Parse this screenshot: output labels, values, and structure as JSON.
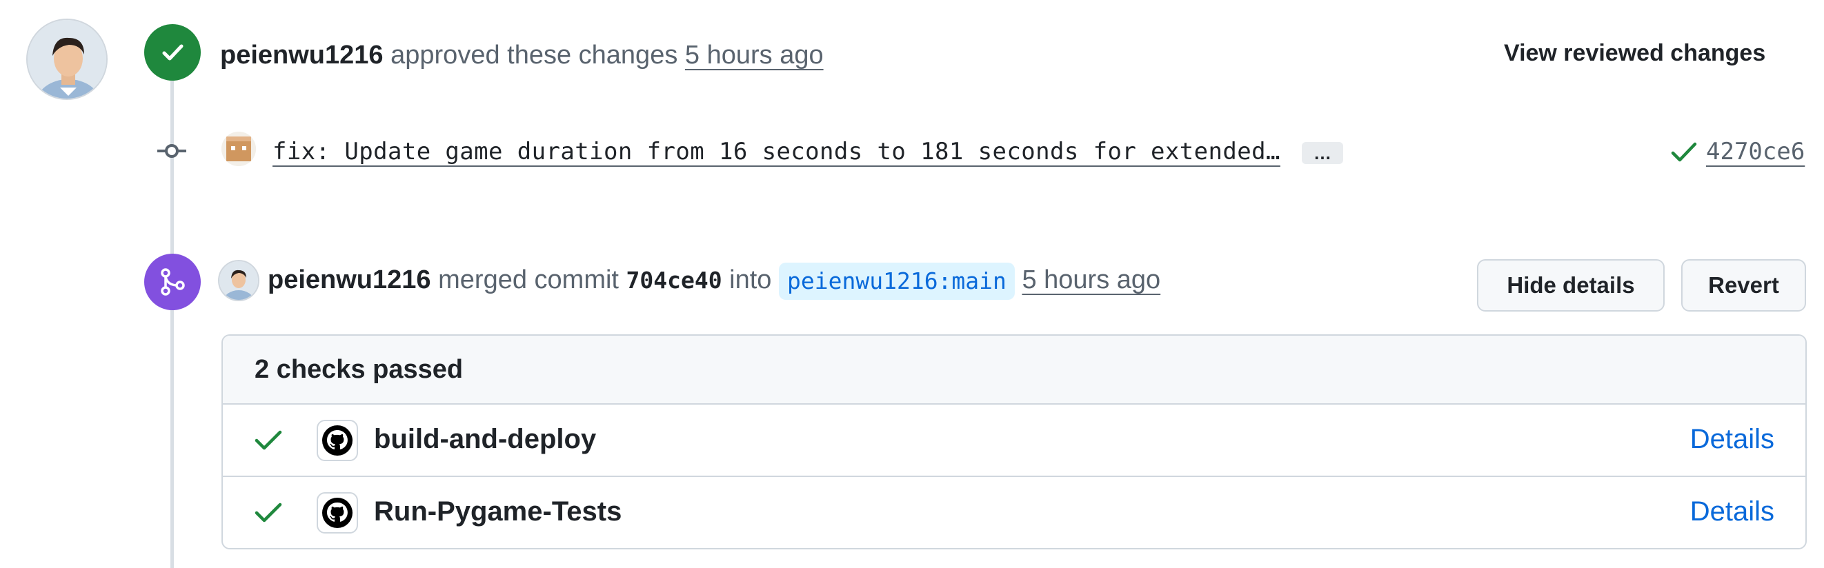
{
  "review_event": {
    "user": "peienwu1216",
    "action": "approved these changes",
    "time": "5 hours ago",
    "view_reviewed_label": "View reviewed changes"
  },
  "commit": {
    "message": "fix: Update game duration from 16 seconds to 181 seconds for extended…",
    "ellipsis_label": "…",
    "sha": "4270ce6",
    "status": "success"
  },
  "merge_event": {
    "user": "peienwu1216",
    "action": "merged commit",
    "commit_sha": "704ce40",
    "into_label": "into",
    "branch": "peienwu1216:main",
    "time": "5 hours ago",
    "hide_details_label": "Hide details",
    "revert_label": "Revert"
  },
  "checks": {
    "summary": "2 checks passed",
    "items": [
      {
        "name": "build-and-deploy",
        "link_label": "Details",
        "status": "success"
      },
      {
        "name": "Run-Pygame-Tests",
        "link_label": "Details",
        "status": "success"
      }
    ]
  },
  "colors": {
    "approved": "#1f883d",
    "merged": "#8250df",
    "link": "#0969da",
    "branch_bg": "#ddf4ff"
  },
  "icons": {
    "approved": "check-icon",
    "merged": "git-merge-icon",
    "commit": "git-commit-icon",
    "check_app": "github-mark-icon"
  }
}
